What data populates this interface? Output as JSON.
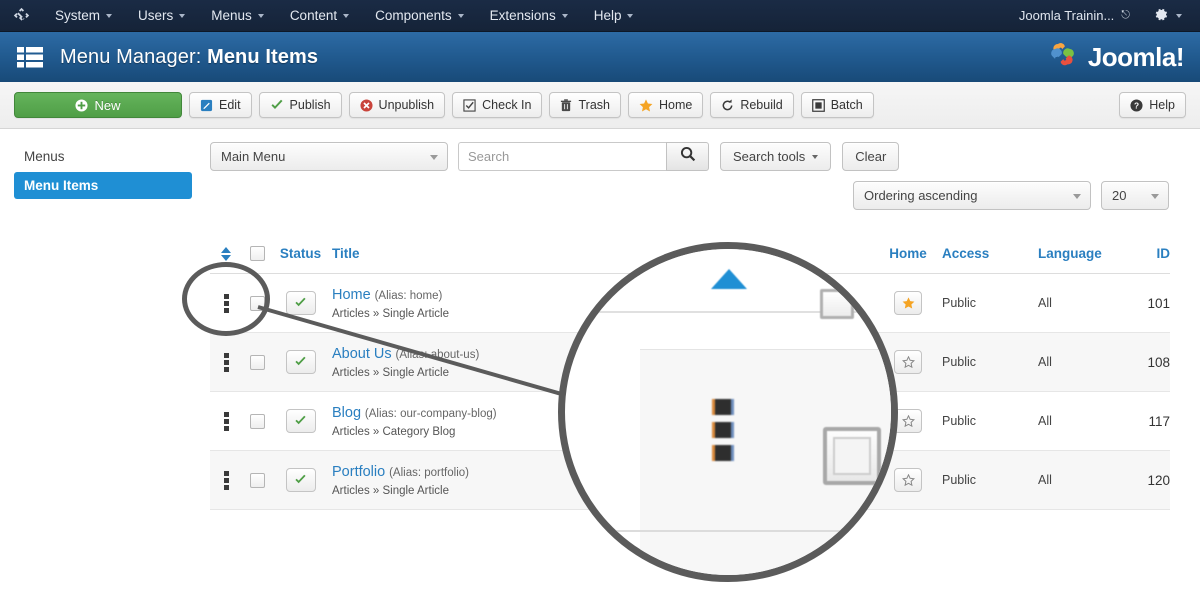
{
  "topnav": {
    "logo_icon": "joomla-brand-icon",
    "items": [
      {
        "label": "System",
        "caret": true
      },
      {
        "label": "Users",
        "caret": true
      },
      {
        "label": "Menus",
        "caret": true
      },
      {
        "label": "Content",
        "caret": true
      },
      {
        "label": "Components",
        "caret": true
      },
      {
        "label": "Extensions",
        "caret": true
      },
      {
        "label": "Help",
        "caret": true
      }
    ],
    "site_name": "Joomla Trainin...",
    "site_link_icon": "external-link-icon",
    "gear_icon": "gear-icon"
  },
  "header": {
    "icon": "list-icon",
    "title_prefix": "Menu Manager:",
    "title_main": "Menu Items",
    "logo_text": "Joomla!",
    "logo_icon": "joomla-logo-icon"
  },
  "toolbar": {
    "buttons": [
      {
        "label": "New",
        "icon": "plus-circle-icon",
        "name": "new-button"
      },
      {
        "label": "Edit",
        "icon": "pencil-square-icon",
        "name": "edit-button"
      },
      {
        "label": "Publish",
        "icon": "check-icon",
        "name": "publish-button"
      },
      {
        "label": "Unpublish",
        "icon": "x-circle-icon",
        "name": "unpublish-button"
      },
      {
        "label": "Check In",
        "icon": "checkbox-icon",
        "name": "checkin-button"
      },
      {
        "label": "Trash",
        "icon": "trash-icon",
        "name": "trash-button"
      },
      {
        "label": "Home",
        "icon": "star-icon",
        "name": "home-button"
      },
      {
        "label": "Rebuild",
        "icon": "refresh-icon",
        "name": "rebuild-button"
      },
      {
        "label": "Batch",
        "icon": "batch-square-icon",
        "name": "batch-button"
      }
    ],
    "help_label": "Help",
    "help_icon": "question-circle-icon"
  },
  "sidebar": {
    "items": [
      {
        "label": "Menus",
        "active": false
      },
      {
        "label": "Menu Items",
        "active": true
      }
    ]
  },
  "filters": {
    "menu_select_value": "Main Menu",
    "search_placeholder": "Search",
    "search_value": "",
    "search_icon": "search-icon",
    "search_tools_label": "Search tools",
    "clear_label": "Clear",
    "ordering_value": "Ordering ascending",
    "limit_value": "20"
  },
  "table": {
    "headers": {
      "ordering": "",
      "checkbox": "",
      "status": "Status",
      "title": "Title",
      "home": "Home",
      "access": "Access",
      "language": "Language",
      "id": "ID"
    },
    "rows": [
      {
        "title": "Home",
        "alias": "(Alias: home)",
        "path": "Articles » Single Article",
        "status": "published",
        "home": true,
        "access": "Public",
        "language": "All",
        "id": "101"
      },
      {
        "title": "About Us",
        "alias": "(Alias: about-us)",
        "path": "Articles » Single Article",
        "status": "published",
        "home": false,
        "access": "Public",
        "language": "All",
        "id": "108"
      },
      {
        "title": "Blog",
        "alias": "(Alias: our-company-blog)",
        "path": "Articles » Category Blog",
        "status": "published",
        "home": false,
        "access": "Public",
        "language": "All",
        "id": "117"
      },
      {
        "title": "Portfolio",
        "alias": "(Alias: portfolio)",
        "path": "Articles » Single Article",
        "status": "published",
        "home": false,
        "access": "Public",
        "language": "All",
        "id": "120"
      }
    ]
  },
  "magnifier": {
    "target": "drag-handle-and-checkbox-of-first-row",
    "circle_color": "#5b5b5b"
  },
  "colors": {
    "topbar": "#152338",
    "header_blue": "#215a8f",
    "accent_blue": "#2a7fc0",
    "active_blue": "#1f8fd4",
    "green": "#4f9e46",
    "orange_star": "#f5a423",
    "red": "#c9443b"
  }
}
